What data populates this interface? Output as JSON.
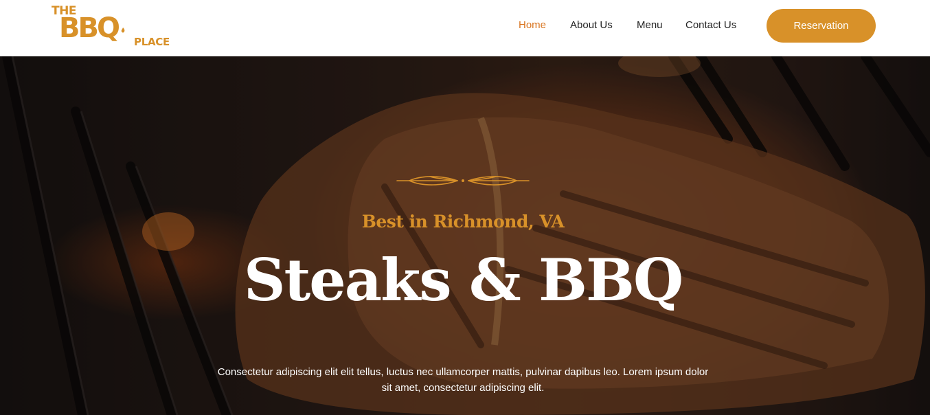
{
  "brand": {
    "logo_the": "THE",
    "logo_bbq": "BBQ",
    "logo_place": "PLACE",
    "logo_icon": "flame-icon",
    "accent_color": "#d89129"
  },
  "nav": {
    "items": [
      {
        "label": "Home",
        "active": true
      },
      {
        "label": "About Us",
        "active": false
      },
      {
        "label": "Menu",
        "active": false
      },
      {
        "label": "Contact Us",
        "active": false
      }
    ],
    "active_color": "#d8731d",
    "reservation_label": "Reservation"
  },
  "hero": {
    "ornament_icon": "divider-ornament-icon",
    "tagline": "Best in Richmond, VA",
    "headline": "Steaks & BBQ",
    "description": "Consectetur adipiscing elit elit tellus, luctus nec ullamcorper mattis, pulvinar dapibus leo. Lorem ipsum dolor sit amet, consectetur adipiscing elit."
  }
}
